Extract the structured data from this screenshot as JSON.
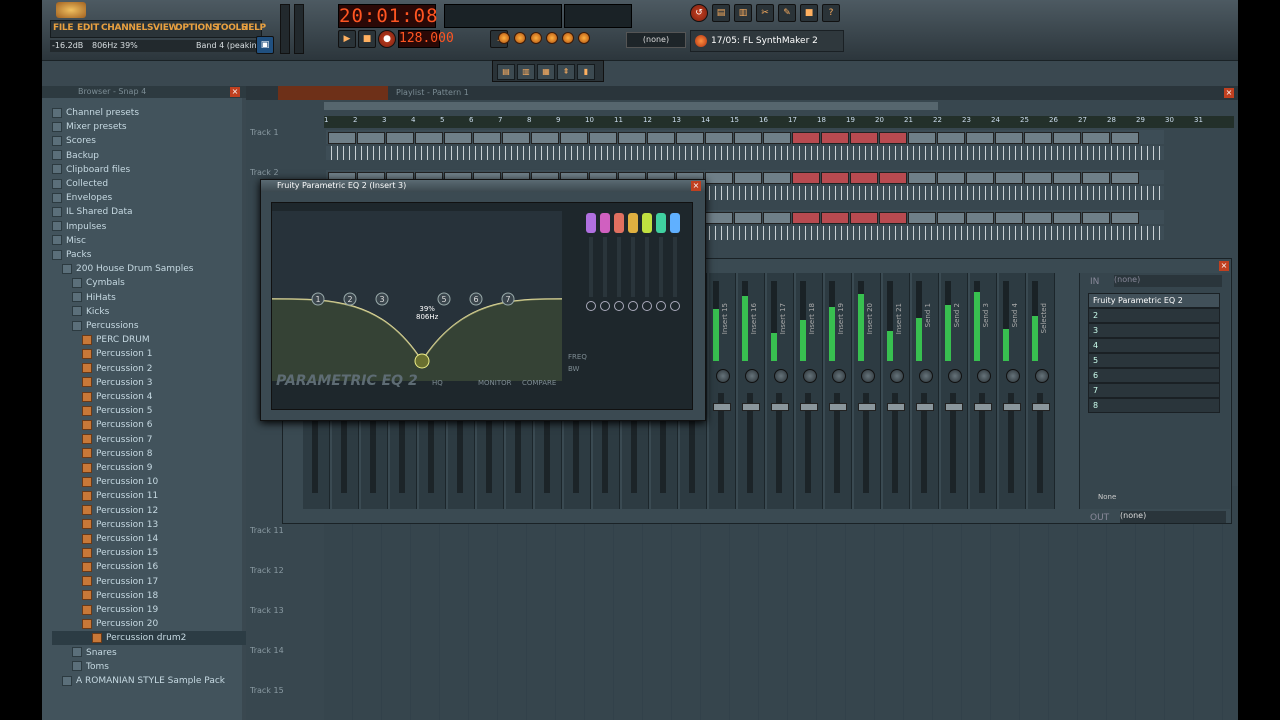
{
  "topbar": {
    "menu": [
      "FILE",
      "EDIT",
      "CHANNELS",
      "VIEW",
      "OPTIONS",
      "TOOLS",
      "HELP"
    ],
    "hint_level": "-16.2dB",
    "hint_freq": "806Hz",
    "hint_percent": "39%",
    "hint_band": "Band 4 (peaking)",
    "time": "20:01:08",
    "tempo": "128.000",
    "pattern_select": "(none)",
    "plugin_label": "17/05: FL SynthMaker 2"
  },
  "browser": {
    "title": "Browser - Snap 4",
    "items": [
      {
        "label": "Channel presets",
        "kind": "folder",
        "indent": 0
      },
      {
        "label": "Mixer presets",
        "kind": "folder",
        "indent": 0
      },
      {
        "label": "Scores",
        "kind": "folder",
        "indent": 0
      },
      {
        "label": "Backup",
        "kind": "folder",
        "indent": 0
      },
      {
        "label": "Clipboard files",
        "kind": "folder",
        "indent": 0
      },
      {
        "label": "Collected",
        "kind": "folder",
        "indent": 0
      },
      {
        "label": "Envelopes",
        "kind": "folder",
        "indent": 0
      },
      {
        "label": "IL Shared Data",
        "kind": "folder",
        "indent": 0
      },
      {
        "label": "Impulses",
        "kind": "folder",
        "indent": 0
      },
      {
        "label": "Misc",
        "kind": "folder",
        "indent": 0
      },
      {
        "label": "Packs",
        "kind": "folder",
        "indent": 0
      },
      {
        "label": "200 House Drum Samples",
        "kind": "folder",
        "indent": 1
      },
      {
        "label": "Cymbals",
        "kind": "folder",
        "indent": 2
      },
      {
        "label": "HiHats",
        "kind": "folder",
        "indent": 2
      },
      {
        "label": "Kicks",
        "kind": "folder",
        "indent": 2
      },
      {
        "label": "Percussions",
        "kind": "folder",
        "indent": 2
      },
      {
        "label": "PERC DRUM",
        "kind": "file",
        "indent": 3
      },
      {
        "label": "Percussion 1",
        "kind": "file",
        "indent": 3
      },
      {
        "label": "Percussion 2",
        "kind": "file",
        "indent": 3
      },
      {
        "label": "Percussion 3",
        "kind": "file",
        "indent": 3
      },
      {
        "label": "Percussion 4",
        "kind": "file",
        "indent": 3
      },
      {
        "label": "Percussion 5",
        "kind": "file",
        "indent": 3
      },
      {
        "label": "Percussion 6",
        "kind": "file",
        "indent": 3
      },
      {
        "label": "Percussion 7",
        "kind": "file",
        "indent": 3
      },
      {
        "label": "Percussion 8",
        "kind": "file",
        "indent": 3
      },
      {
        "label": "Percussion 9",
        "kind": "file",
        "indent": 3
      },
      {
        "label": "Percussion 10",
        "kind": "file",
        "indent": 3
      },
      {
        "label": "Percussion 11",
        "kind": "file",
        "indent": 3
      },
      {
        "label": "Percussion 12",
        "kind": "file",
        "indent": 3
      },
      {
        "label": "Percussion 13",
        "kind": "file",
        "indent": 3
      },
      {
        "label": "Percussion 14",
        "kind": "file",
        "indent": 3
      },
      {
        "label": "Percussion 15",
        "kind": "file",
        "indent": 3
      },
      {
        "label": "Percussion 16",
        "kind": "file",
        "indent": 3
      },
      {
        "label": "Percussion 17",
        "kind": "file",
        "indent": 3
      },
      {
        "label": "Percussion 18",
        "kind": "file",
        "indent": 3
      },
      {
        "label": "Percussion 19",
        "kind": "file",
        "indent": 3
      },
      {
        "label": "Percussion 20",
        "kind": "file",
        "indent": 3
      },
      {
        "label": "Percussion drum2",
        "kind": "file",
        "indent": 4
      },
      {
        "label": "Snares",
        "kind": "folder",
        "indent": 2
      },
      {
        "label": "Toms",
        "kind": "folder",
        "indent": 2
      },
      {
        "label": "A ROMANIAN STYLE Sample Pack",
        "kind": "folder",
        "indent": 1
      }
    ]
  },
  "playlist": {
    "title": "Playlist - Pattern 1",
    "ruler": [
      "1",
      "2",
      "3",
      "4",
      "5",
      "6",
      "7",
      "8",
      "9",
      "10",
      "11",
      "12",
      "13",
      "14",
      "15",
      "16",
      "17",
      "18",
      "19",
      "20",
      "21",
      "22",
      "23",
      "24",
      "25",
      "26",
      "27",
      "28",
      "29",
      "30",
      "31"
    ],
    "tracks": [
      "Track 1",
      "Track 2",
      "Track 11",
      "Track 12",
      "Track 13",
      "Track 14",
      "Track 15"
    ]
  },
  "mixer": {
    "inserts": [
      "Insert 15",
      "Insert 16",
      "Insert 17",
      "Insert 18",
      "Insert 19",
      "Insert 20",
      "Insert 21",
      "Send 1",
      "Send 2",
      "Send 3",
      "Send 4",
      "Selected"
    ],
    "in_label": "IN",
    "in_value": "(none)",
    "fx_slots": [
      "Fruity Parametric EQ 2",
      "2",
      "3",
      "4",
      "5",
      "6",
      "7",
      "8"
    ],
    "out_label": "OUT",
    "out_value": "(none)",
    "none_label": "None"
  },
  "eq": {
    "title": "Fruity Parametric EQ 2 (Insert 3)",
    "logo": "PARAMETRIC EQ 2",
    "tooltip_pct": "39%",
    "tooltip_freq": "806Hz",
    "freq_label": "FREQ",
    "bw_label": "BW",
    "monitor": "MONITOR",
    "compare": "COMPARE",
    "hq": "HQ",
    "band_colors": [
      "#b070e0",
      "#d060c0",
      "#e07060",
      "#e0b040",
      "#c0e040",
      "#40d0a0",
      "#60b0ff"
    ],
    "band_numbers": [
      "1",
      "2",
      "3",
      "5",
      "6",
      "7"
    ]
  }
}
